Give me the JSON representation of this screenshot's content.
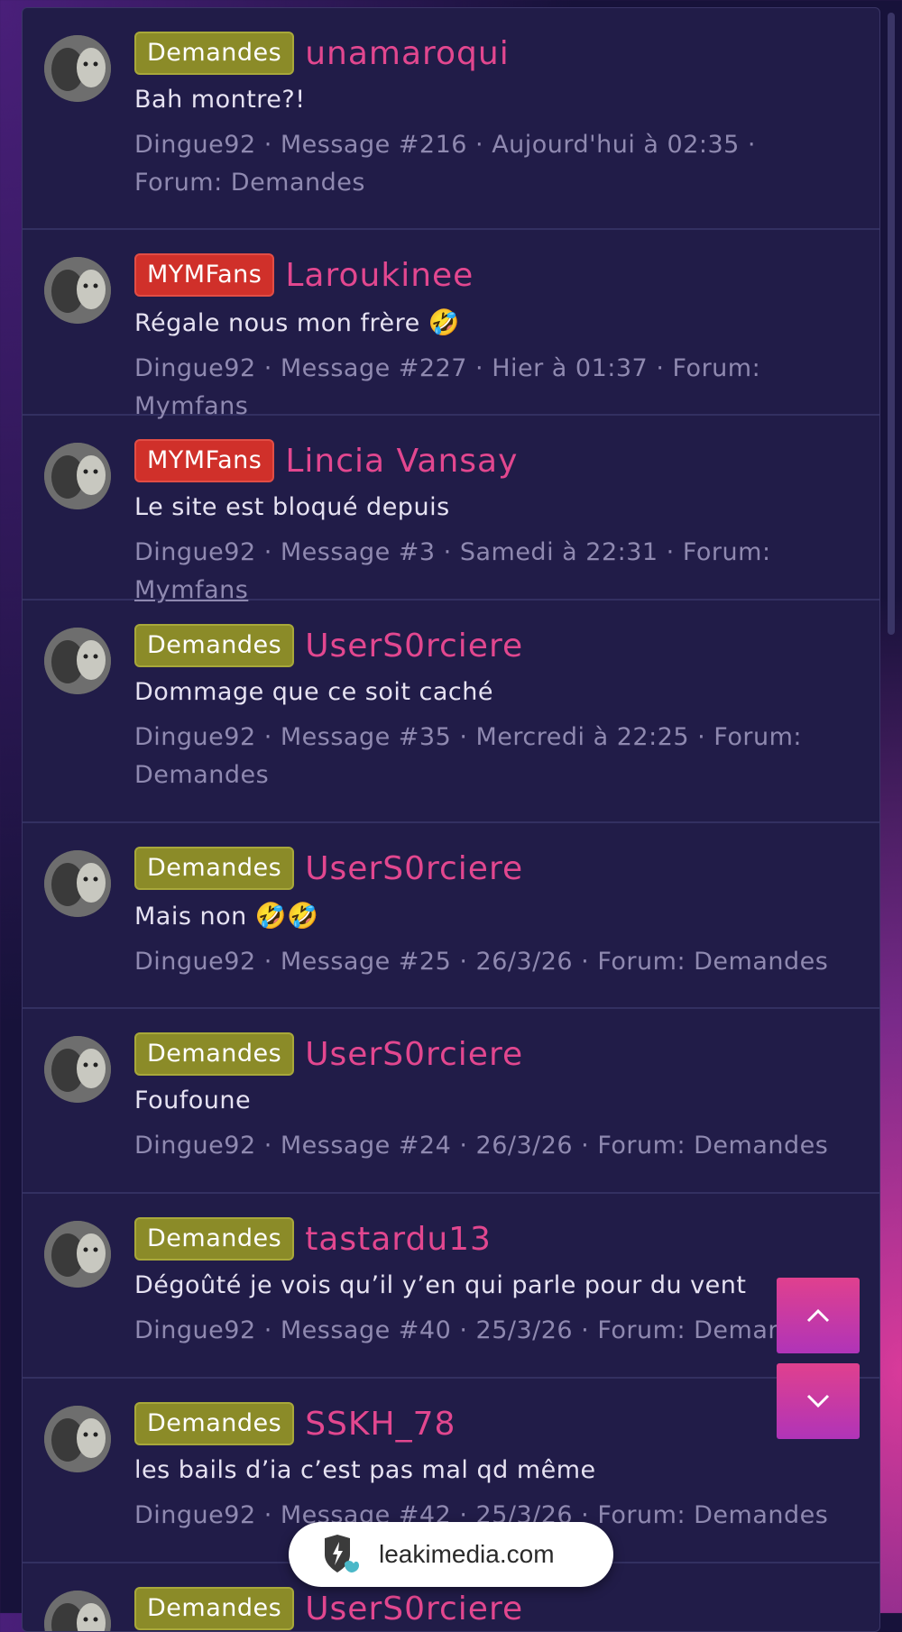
{
  "results": [
    {
      "badge": "Demandes",
      "badge_type": "demandes",
      "thread": "unamaroqui",
      "snippet": "Bah montre?!",
      "emoji": "",
      "meta": "Dingue92 · Message #216 · Aujourd'hui à 02:35 · Forum: Demandes",
      "forum_link": ""
    },
    {
      "badge": "MYMFans",
      "badge_type": "mymfans",
      "thread": "Laroukinee",
      "snippet": "Régale nous mon frère",
      "emoji": "🤣",
      "meta": "Dingue92 · Message #227 · Hier à 01:37 · Forum: Mymfans",
      "forum_link": ""
    },
    {
      "badge": "MYMFans",
      "badge_type": "mymfans",
      "thread": "Lincia Vansay",
      "snippet": "Le site est bloqué depuis",
      "emoji": "",
      "meta": "Dingue92 · Message #3 · Samedi à 22:31 · Forum: ",
      "forum_link": "Mymfans"
    },
    {
      "badge": "Demandes",
      "badge_type": "demandes",
      "thread": "UserS0rciere",
      "snippet": "Dommage que ce soit caché",
      "emoji": "",
      "meta": "Dingue92 · Message #35 · Mercredi à 22:25 · Forum: Demandes",
      "forum_link": ""
    },
    {
      "badge": "Demandes",
      "badge_type": "demandes",
      "thread": "UserS0rciere",
      "snippet": "Mais non",
      "emoji": "🤣🤣",
      "meta": "Dingue92 · Message #25 · 26/3/26 · Forum: Demandes",
      "forum_link": ""
    },
    {
      "badge": "Demandes",
      "badge_type": "demandes",
      "thread": "UserS0rciere",
      "snippet": "Foufoune",
      "emoji": "",
      "meta": "Dingue92 · Message #24 · 26/3/26 · Forum: Demandes",
      "forum_link": ""
    },
    {
      "badge": "Demandes",
      "badge_type": "demandes",
      "thread": "tastardu13",
      "snippet": "Dégoûté je vois qu’il y’en qui parle pour du vent",
      "emoji": "",
      "meta": "Dingue92 · Message #40 · 25/3/26 · Forum: Demandes",
      "forum_link": ""
    },
    {
      "badge": "Demandes",
      "badge_type": "demandes",
      "thread": "SSKH_78",
      "snippet": "les bails d’ia c’est pas mal qd même",
      "emoji": "",
      "meta": "Dingue92 · Message #42 · 25/3/26 · Forum: Demandes",
      "forum_link": ""
    },
    {
      "badge": "Demandes",
      "badge_type": "demandes",
      "thread": "UserS0rciere",
      "snippet": "",
      "emoji": "",
      "meta": "",
      "forum_link": ""
    }
  ],
  "toast": {
    "domain": "leakimedia.com"
  },
  "icons": {
    "scroll_up": "chevron-up-icon",
    "scroll_down": "chevron-down-icon",
    "toast": "shield-icon"
  }
}
